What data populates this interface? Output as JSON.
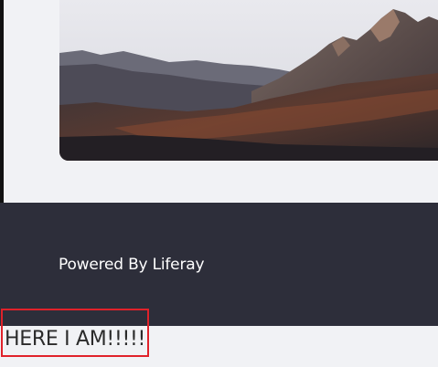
{
  "hero": {
    "image": "mountain-landscape"
  },
  "footer": {
    "powered_by": "Powered By Liferay",
    "background": "#2d2e3a"
  },
  "custom_text": {
    "label": "HERE I AM!!!!!",
    "highlight_color": "#e0222a"
  }
}
